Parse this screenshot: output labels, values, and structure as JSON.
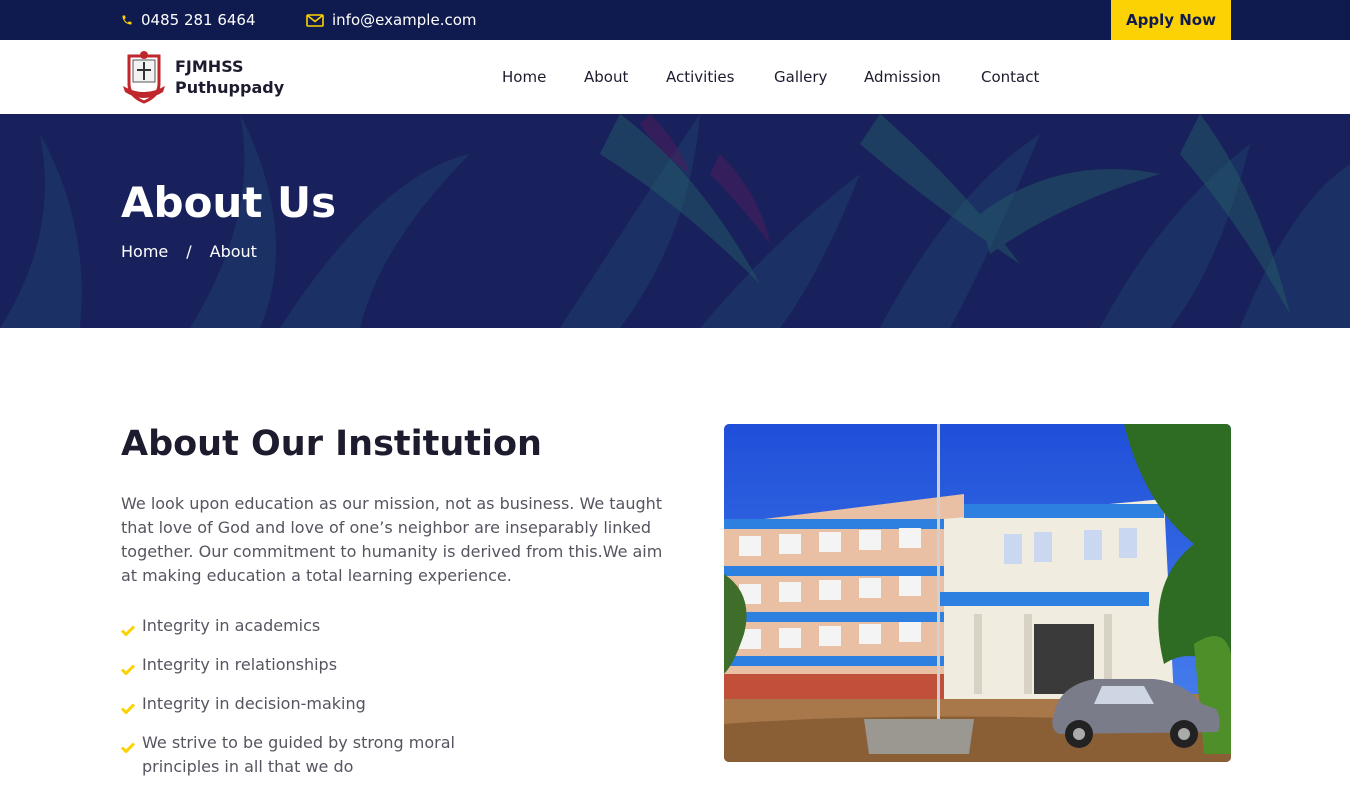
{
  "topbar": {
    "phone": "0485 281 6464",
    "email": "info@example.com",
    "apply_label": "Apply Now",
    "icons": [
      "phone-icon",
      "envelope-icon"
    ],
    "accent": "#fdd204",
    "background": "#0f1a4f"
  },
  "brand": {
    "line1": "FJMHSS",
    "line2": "Puthuppady"
  },
  "nav": {
    "items": [
      "Home",
      "About",
      "Activities",
      "Gallery",
      "Admission",
      "Contact"
    ]
  },
  "hero": {
    "title": "About Us",
    "breadcrumb": [
      "Home",
      "/",
      "About"
    ]
  },
  "about": {
    "title": "About Our Institution",
    "intro": "We look upon education as our mission, not as business. We taught that love of God and love of one’s neighbor are inseparably linked together. Our commitment to humanity is derived from this.We aim at making education a total learning experience.",
    "features": [
      "Integrity in academics",
      "Integrity in relationships",
      "Integrity in decision-making",
      "We strive to be guided by strong moral principles in all that we do"
    ]
  }
}
